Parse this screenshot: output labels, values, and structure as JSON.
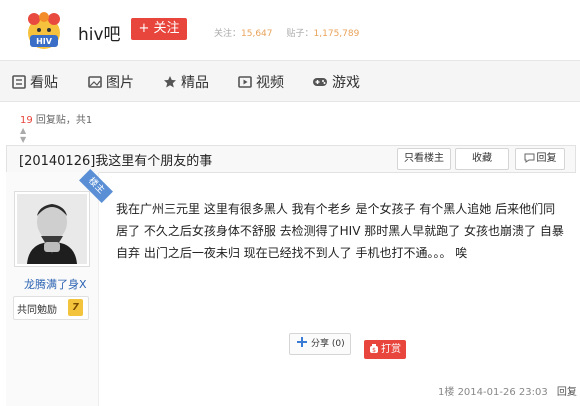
{
  "header": {
    "forum_name": "hiv吧",
    "follow_label": "+ 关注",
    "followers_label": "关注：",
    "followers_count": "15,647",
    "posts_label": "贴子：",
    "posts_count": "1,175,789",
    "logo_icon": "tieba-hiv-logo"
  },
  "nav": [
    {
      "label": "看贴",
      "icon": "list-icon"
    },
    {
      "label": "图片",
      "icon": "image-icon"
    },
    {
      "label": "精品",
      "icon": "star-icon"
    },
    {
      "label": "视频",
      "icon": "video-icon"
    },
    {
      "label": "游戏",
      "icon": "gamepad-icon"
    }
  ],
  "thread_info": {
    "reply_count": "19",
    "reply_label": "回复贴，共",
    "pages": "1"
  },
  "thread": {
    "title": "[20140126]我这里有个朋友的事",
    "only_op_label": "只看楼主",
    "favorite_label": "收藏",
    "reply_label": "回复"
  },
  "post": {
    "op_tag": "楼主",
    "username": "龙腾满了身X",
    "badge_label": "共同勉励",
    "level": "7",
    "content": "我在广州三元里 这里有很多黑人 我有个老乡 是个女孩子 有个黑人追她 后来他们同居了 不久之后女孩身体不舒服 去检测得了HIV 那时黑人早就跑了 女孩也崩溃了 自暴自弃 出门之后一夜未归 现在已经找不到人了 手机也打不通。。。 唉",
    "share_label": "分享",
    "share_count": "(0)",
    "reward_label": "打赏",
    "floor": "1楼",
    "timestamp": "2014-01-26 23:03",
    "reply_label": "回复"
  },
  "colors": {
    "accent_red": "#e8453c",
    "link_blue": "#2d64b3",
    "stat_orange": "#e8a35a",
    "op_tag_blue": "#5a8fd6"
  }
}
